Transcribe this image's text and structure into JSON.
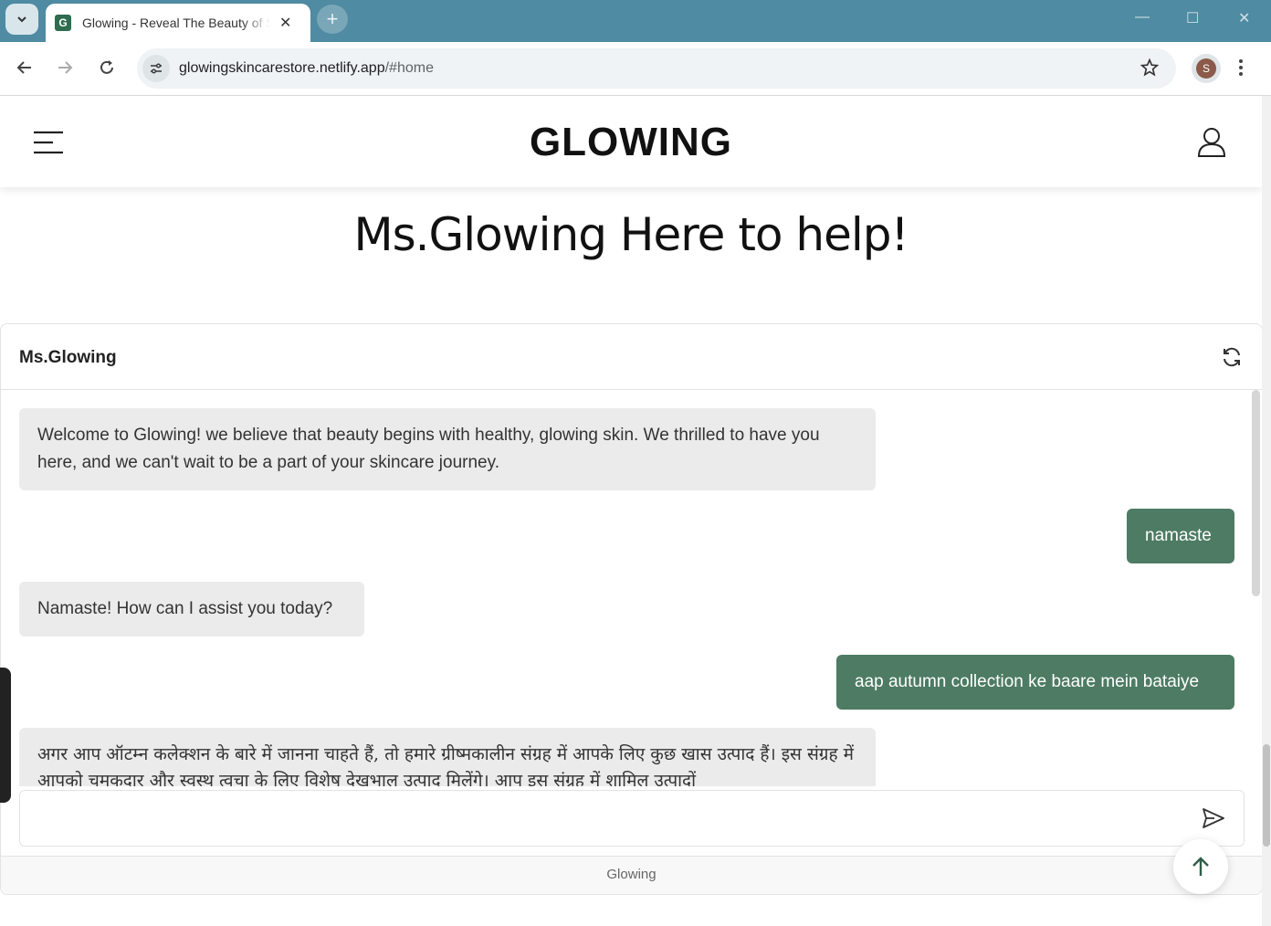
{
  "browser": {
    "tab_title": "Glowing - Reveal The Beauty of Skin",
    "favicon_letter": "G",
    "url_host": "glowingskincarestore.netlify.app",
    "url_path": "/#home",
    "profile_initial": "S"
  },
  "header": {
    "logo": "GLOWING"
  },
  "page": {
    "title": "Ms.Glowing Here to help!"
  },
  "chat": {
    "name": "Ms.Glowing",
    "messages": [
      {
        "role": "bot",
        "text": "Welcome to Glowing! we believe that beauty begins with healthy, glowing skin. We thrilled to have you here, and we can't wait to be a part of your skincare journey."
      },
      {
        "role": "user",
        "text": "namaste"
      },
      {
        "role": "bot",
        "text": "Namaste! How can I assist you today?"
      },
      {
        "role": "user",
        "text": "aap autumn collection ke baare mein bataiye"
      },
      {
        "role": "bot",
        "text": "अगर आप ऑटम्न कलेक्शन के बारे में जानना चाहते हैं, तो हमारे ग्रीष्मकालीन संग्रह में आपके लिए कुछ खास उत्पाद हैं। इस संग्रह में आपको चमकदार और स्वस्थ त्वचा के लिए विशेष देखभाल उत्पाद मिलेंगे। आप इस संग्रह में शामिल उत्पादों"
      }
    ],
    "input_value": "",
    "footer": "Glowing"
  },
  "icons": {
    "menu": "hamburger-icon",
    "user": "user-icon",
    "refresh": "refresh-icon",
    "send": "send-icon",
    "scroll_top": "arrow-up-icon"
  },
  "colors": {
    "accent": "#4d7b63",
    "tabbar": "#4f8ba2",
    "bot_bubble": "#ebebeb"
  }
}
